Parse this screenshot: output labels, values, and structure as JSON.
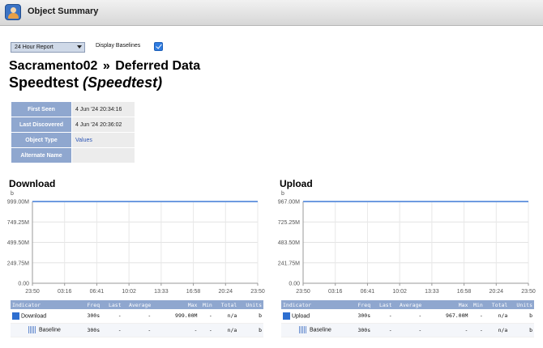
{
  "window": {
    "title": "Object Summary",
    "icon": "user-app-icon"
  },
  "controls": {
    "report_select": "24 Hour Report",
    "baselines_label": "Display Baselines",
    "baselines_checked": true
  },
  "breadcrumb": {
    "parent": "Sacramento02",
    "separator": "»",
    "section": "Deferred Data"
  },
  "heading": {
    "name": "Speedtest",
    "type": "(Speedtest)"
  },
  "properties": [
    {
      "label": "First Seen",
      "value": "4 Jun '24 20:34:16"
    },
    {
      "label": "Last Discovered",
      "value": "4 Jun '24 20:36:02"
    },
    {
      "label": "Object Type",
      "value": "Values"
    },
    {
      "label": "Alternate Name",
      "value": ""
    }
  ],
  "colors": {
    "accent": "#8fa7cf",
    "series": "#6e9be0",
    "link": "#2d56b5"
  },
  "table_headers": [
    "Indicator",
    "Freq",
    "Last",
    "Average",
    "Max",
    "Min",
    "Total",
    "Units"
  ],
  "chart_data": [
    {
      "type": "line",
      "title": "Download",
      "unit": "b",
      "x_ticks": [
        "23:50",
        "03:16",
        "06:41",
        "10:02",
        "13:33",
        "16:58",
        "20:24",
        "23:50"
      ],
      "y_ticks": [
        "999.00M",
        "749.25M",
        "499.50M",
        "249.75M",
        "0.00"
      ],
      "y_tick_values": [
        999000000,
        749250000,
        499500000,
        249750000,
        0
      ],
      "ylim": [
        0,
        999000000
      ],
      "grid": true,
      "series": [
        {
          "name": "Download",
          "x": [
            "23:50",
            "23:50"
          ],
          "values": [
            999000000,
            999000000
          ]
        }
      ],
      "indicators": [
        {
          "name": "Download",
          "freq": "300s",
          "last": "-",
          "average": "-",
          "max": "999.00M",
          "min": "-",
          "total": "n/a",
          "units": "b"
        },
        {
          "name": "Baseline",
          "freq": "300s",
          "last": "-",
          "average": "-",
          "max": "-",
          "min": "-",
          "total": "n/a",
          "units": "b"
        }
      ]
    },
    {
      "type": "line",
      "title": "Upload",
      "unit": "b",
      "x_ticks": [
        "23:50",
        "03:16",
        "06:41",
        "10:02",
        "13:33",
        "16:58",
        "20:24",
        "23:50"
      ],
      "y_ticks": [
        "967.00M",
        "725.25M",
        "483.50M",
        "241.75M",
        "0.00"
      ],
      "y_tick_values": [
        967000000,
        725250000,
        483500000,
        241750000,
        0
      ],
      "ylim": [
        0,
        967000000
      ],
      "grid": true,
      "series": [
        {
          "name": "Upload",
          "x": [
            "23:50",
            "23:50"
          ],
          "values": [
            967000000,
            967000000
          ]
        }
      ],
      "indicators": [
        {
          "name": "Upload",
          "freq": "300s",
          "last": "-",
          "average": "-",
          "max": "967.00M",
          "min": "-",
          "total": "n/a",
          "units": "b"
        },
        {
          "name": "Baseline",
          "freq": "300s",
          "last": "-",
          "average": "-",
          "max": "-",
          "min": "-",
          "total": "n/a",
          "units": "b"
        }
      ]
    }
  ]
}
